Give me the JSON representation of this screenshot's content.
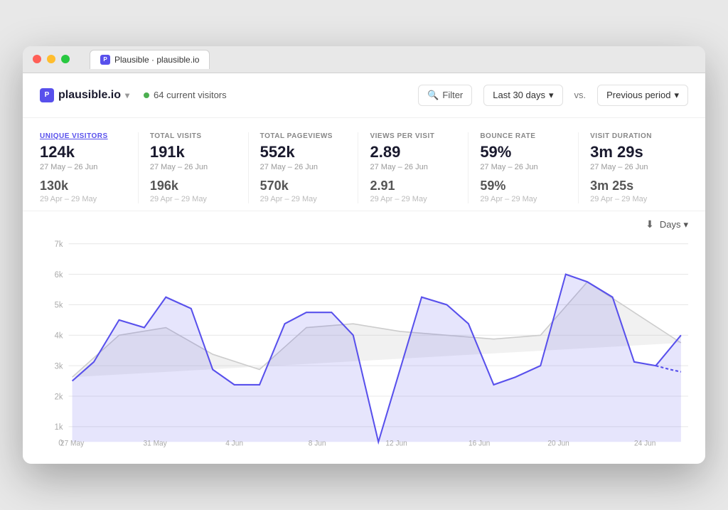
{
  "window": {
    "tab_label": "Plausible · plausible.io"
  },
  "header": {
    "logo_text": "plausible.io",
    "logo_chevron": "▾",
    "visitors_count": "64 current visitors",
    "filter_label": "Filter",
    "date_range_label": "Last 30 days",
    "vs_label": "vs.",
    "period_label": "Previous period",
    "chevron": "▾"
  },
  "stats": [
    {
      "label": "UNIQUE VISITORS",
      "active": true,
      "value": "124k",
      "date": "27 May – 26 Jun",
      "prev_value": "130k",
      "prev_date": "29 Apr – 29 May"
    },
    {
      "label": "TOTAL VISITS",
      "active": false,
      "value": "191k",
      "date": "27 May – 26 Jun",
      "prev_value": "196k",
      "prev_date": "29 Apr – 29 May"
    },
    {
      "label": "TOTAL PAGEVIEWS",
      "active": false,
      "value": "552k",
      "date": "27 May – 26 Jun",
      "prev_value": "570k",
      "prev_date": "29 Apr – 29 May"
    },
    {
      "label": "VIEWS PER VISIT",
      "active": false,
      "value": "2.89",
      "date": "27 May – 26 Jun",
      "prev_value": "2.91",
      "prev_date": "29 Apr – 29 May"
    },
    {
      "label": "BOUNCE RATE",
      "active": false,
      "value": "59%",
      "date": "27 May – 26 Jun",
      "prev_value": "59%",
      "prev_date": "29 Apr – 29 May"
    },
    {
      "label": "VISIT DURATION",
      "active": false,
      "value": "3m 29s",
      "date": "27 May – 26 Jun",
      "prev_value": "3m 25s",
      "prev_date": "29 Apr – 29 May"
    }
  ],
  "chart": {
    "download_label": "⬇",
    "granularity_label": "Days",
    "granularity_chevron": "▾",
    "y_labels": [
      "7k",
      "6k",
      "5k",
      "4k",
      "3k",
      "2k",
      "1k",
      "0"
    ],
    "x_labels": [
      "27 May",
      "31 May",
      "4 Jun",
      "8 Jun",
      "12 Jun",
      "16 Jun",
      "20 Jun",
      "24 Jun"
    ]
  }
}
